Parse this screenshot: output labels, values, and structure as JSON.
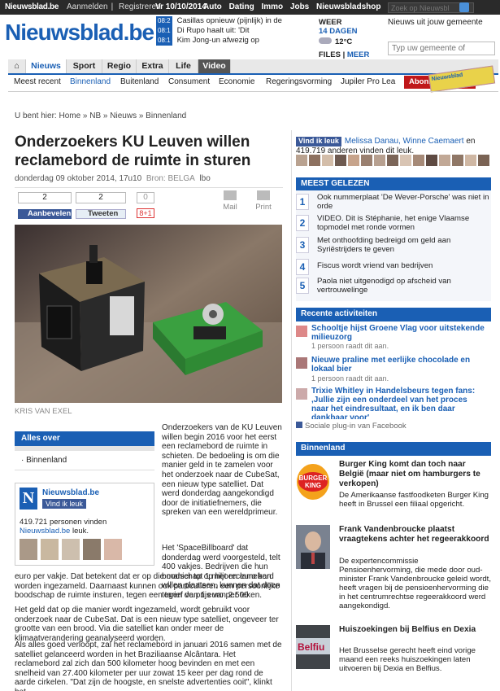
{
  "topbar": {
    "logo": "Nieuwsblad.be",
    "login": "Aanmelden",
    "sep": "|",
    "register": "Registreren",
    "date": "Vr 10/10/2014",
    "categories": [
      "Auto",
      "Dating",
      "Immo",
      "Jobs",
      "Nieuwsbladshop"
    ],
    "search_placeholder": "Zoek op Nieuwsbl"
  },
  "header": {
    "logo": "Nieuwsblad.be",
    "ticker": [
      {
        "time": "08:2",
        "text": "Casillas opnieuw (pijnlijk) in de"
      },
      {
        "time": "08:1",
        "text": "Di Rupo haalt uit: 'Dit"
      },
      {
        "time": "08:1",
        "text": "Kim Jong-un afwezig op"
      }
    ],
    "weather_title": "WEER",
    "weather_link": "14 DAGEN",
    "temp": "12°C",
    "files": "FILES",
    "files_sep": "|",
    "meer": "MEER",
    "gemeente_title": "Nieuws uit jouw gemeente",
    "gemeente_placeholder": "Typ uw gemeente of"
  },
  "nav": {
    "items": [
      "Nieuws",
      "Sport",
      "Regio",
      "Extra",
      "Life",
      "Video"
    ],
    "sub": [
      "Meest recent",
      "Binnenland",
      "Buitenland",
      "Consument",
      "Economie",
      "Regeringsvorming",
      "Jupiler Pro Lea"
    ],
    "abonneer": "Abonneer n",
    "badge": "Nieuwsblad"
  },
  "article": {
    "breadcrumb": "U bent hier: Home » NB » Nieuws » Binnenland",
    "title": "Onderzoekers KU Leuven willen reclamebord de ruimte in sturen",
    "date": "donderdag 09 oktober 2014, 17u10",
    "source_label": "Bron: BELGA",
    "author": "lbo",
    "share": {
      "fb_count": "2",
      "tw_count": "2",
      "gp_count": "0",
      "fb_label": "Aanbevelen",
      "tw_label": "Tweeten",
      "gp_label": "8+1",
      "mail": "Mail",
      "print": "Print"
    },
    "photo_credit": "KRIS VAN EXEL",
    "alles_over": {
      "title": "Alles over",
      "items": [
        "Binnenland"
      ]
    },
    "fb_widget": {
      "logo": "N",
      "name": "Nieuwsblad.be",
      "like": "Vind ik leuk",
      "count": "419.721 personen vinden",
      "count_link": "Nieuwsblad.be",
      "count_tail": "leuk."
    },
    "paragraphs": [
      "Onderzoekers van de KU Leuven willen begin 2016 voor het eerst een reclamebord de ruimte in schieten. De bedoeling is om die manier geld in te zamelen voor het onderzoek naar de CubeSat, een nieuw type satelliet. Dat werd donderdag aangekondigd door de initiatiefnemers, die spreken van een wereldprimeur.",
      "Het 'SpaceBillboard' dat donderdag werd voorgesteld, telt 400 vakjes. Bedrijven die hun boodschap op het reclamebord willen plaatsen, kunnen dat doen tegen de prijs van 2.500",
      "euro per vakje. Dat betekent dat er op die manier tot 1 miljoen euro kan worden ingezameld. Daarnaast kunnen ook particulieren een persoonlijke boodschap de ruimte insturen, tegen een tarief van 1 euro per teken.",
      "Het geld dat op die manier wordt ingezameld, wordt gebruikt voor onderzoek naar de CubeSat. Dat is een nieuw type satelliet, ongeveer ter grootte van een brood. Via die satelliet kan onder meer de klimaatverandering geanalyseerd worden.",
      "Als alles goed verloopt, zal het reclamebord in januari 2016 samen met de satelliet gelanceerd worden in het Braziliaanse Alcântara. Het reclamebord zal zich dan 500 kilometer hoog bevinden en met een snelheid van 27.400 kilometer per uur zowat 15 keer per dag rond de aarde cirkelen. \"Dat zijn de hoogste, en snelste advertenties ooit\", klinkt het."
    ]
  },
  "sidebar": {
    "fb": {
      "like": "Vind ik leuk",
      "names": "Melissa Danau, Winne Caemaert",
      "and": "en",
      "count": "419.719 anderen vinden dit leuk."
    },
    "meest_gelezen": {
      "title": "MEEST GELEZEN",
      "items": [
        {
          "num": "1",
          "text": "Ook nummerplaat 'De Wever-Porsche' was niet in orde"
        },
        {
          "num": "2",
          "text": "VIDEO. Dit is Stéphanie, het enige Vlaamse topmodel met ronde vormen"
        },
        {
          "num": "3",
          "text": "Met onthoofding bedreigd om geld aan Syriëstrijders te geven"
        },
        {
          "num": "4",
          "text": "Fiscus wordt vriend van bedrijven"
        },
        {
          "num": "5",
          "text": "Paola niet uitgenodigd op afscheid van vertrouwelinge"
        }
      ]
    },
    "recente": {
      "title": "Recente activiteiten",
      "items": [
        {
          "title": "Schooltje hijst Groene Vlag voor uitstekende milieuzorg",
          "sub": "1 persoon raadt dit aan."
        },
        {
          "title": "Nieuwe praline met eerlijke chocolade en lokaal bier",
          "sub": "1 persoon raadt dit aan."
        },
        {
          "title": "Trixie Whitley in Handelsbeurs tegen fans: ,Jullie zijn een onderdeel van het proces naar het eindresultaat, en ik ben daar dankbaar voor'",
          "sub": ""
        }
      ],
      "plugin": "Sociale plug-in van Facebook"
    },
    "binnenland": {
      "title": "Binnenland",
      "items": [
        {
          "title": "Burger King komt dan toch naar België (maar niet om hamburgers te verkopen)",
          "text": "De Amerikaanse fastfoodketen Burger King heeft in Brussel een filiaal opgericht.",
          "img_text": "BURGER KING"
        },
        {
          "title": "Frank Vandenbroucke plaatst vraagtekens achter het regeerakkoord",
          "text": "De expertencommissie Pensioenhervorming, die mede door oud-minister Frank Vandenbroucke geleid wordt, heeft vragen bij de pensioenhervorming die in het centrumrechtse regeerakkoord werd aangekondigd.",
          "img_text": ""
        },
        {
          "title": "Huiszoekingen bij Belfius en Dexia",
          "text": "Het Brusselse gerecht heeft eind vorige maand een reeks huiszoekingen laten uitvoeren bij Dexia en Belfius.",
          "img_text": "Belfiu"
        }
      ]
    }
  }
}
